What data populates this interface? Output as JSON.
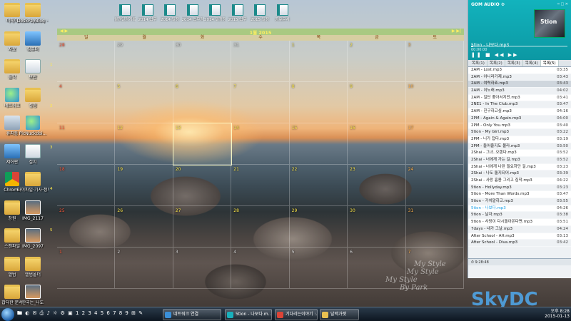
{
  "desktop": {
    "left_icons": [
      {
        "label": "더메이",
        "type": "folder"
      },
      {
        "label": "DeskPayBlog - 바로 가기",
        "type": "folder"
      },
      {
        "label": "자료",
        "type": "folder"
      },
      {
        "label": "컴퓨터",
        "type": "pc"
      },
      {
        "label": "음악",
        "type": "folder"
      },
      {
        "label": "보관",
        "type": "doc"
      },
      {
        "label": "네트워크",
        "type": "globe"
      },
      {
        "label": "설정",
        "type": "folder"
      },
      {
        "label": "휴지통",
        "type": "trash"
      },
      {
        "label": "PicNuckdoi...",
        "type": "globe"
      },
      {
        "label": "제어판",
        "type": "pc"
      },
      {
        "label": "설치",
        "type": "doc"
      },
      {
        "label": "Chrome",
        "type": "chrome"
      },
      {
        "label": "마이파일·기사·정보",
        "type": "folder"
      },
      {
        "label": "창원",
        "type": "folder"
      },
      {
        "label": "IMG_2117",
        "type": "photo"
      },
      {
        "label": "스캔파일",
        "type": "folder"
      },
      {
        "label": "IMG_2097",
        "type": "photo"
      },
      {
        "label": "앨범",
        "type": "folder"
      },
      {
        "label": "앨범폴더",
        "type": "folder"
      },
      {
        "label": "잡다한 문서",
        "type": "folder"
      },
      {
        "label": "한국는_나도",
        "type": "photo"
      }
    ],
    "top_icons": [
      {
        "label": "월간일정기록"
      },
      {
        "label": "2014 업무"
      },
      {
        "label": "2014 일정"
      },
      {
        "label": "2014 업무정리"
      },
      {
        "label": "2014 일정정리"
      },
      {
        "label": "2015 업무"
      },
      {
        "label": "2015 일정"
      },
      {
        "label": "공유문서"
      }
    ],
    "watermark": [
      "My Style",
      "My Style",
      "My Style",
      "By Park"
    ],
    "brand": "SkyDC"
  },
  "calendar": {
    "title": "1월 2015",
    "prev": "◀ ▶",
    "next": "▶ ▶|",
    "weekdays": [
      "일",
      "월",
      "화",
      "수",
      "목",
      "금",
      "토"
    ],
    "weeks": [
      [
        {
          "d": "28",
          "o": true
        },
        {
          "d": "29",
          "o": true
        },
        {
          "d": "30",
          "o": true
        },
        {
          "d": "31",
          "o": true
        },
        {
          "d": "1"
        },
        {
          "d": "2"
        },
        {
          "d": "3"
        }
      ],
      [
        {
          "d": "4"
        },
        {
          "d": "5"
        },
        {
          "d": "6"
        },
        {
          "d": "7"
        },
        {
          "d": "8"
        },
        {
          "d": "9"
        },
        {
          "d": "10"
        }
      ],
      [
        {
          "d": "11"
        },
        {
          "d": "12"
        },
        {
          "d": "13",
          "today": true
        },
        {
          "d": "14"
        },
        {
          "d": "15"
        },
        {
          "d": "16"
        },
        {
          "d": "17"
        }
      ],
      [
        {
          "d": "18"
        },
        {
          "d": "19"
        },
        {
          "d": "20"
        },
        {
          "d": "21"
        },
        {
          "d": "22"
        },
        {
          "d": "23"
        },
        {
          "d": "24"
        }
      ],
      [
        {
          "d": "25"
        },
        {
          "d": "26"
        },
        {
          "d": "27"
        },
        {
          "d": "28"
        },
        {
          "d": "29"
        },
        {
          "d": "30"
        },
        {
          "d": "31"
        }
      ],
      [
        {
          "d": "1",
          "o": true
        },
        {
          "d": "2",
          "o": true
        },
        {
          "d": "3",
          "o": true
        },
        {
          "d": "4",
          "o": true
        },
        {
          "d": "5",
          "o": true
        },
        {
          "d": "6",
          "o": true
        },
        {
          "d": "7",
          "o": true
        }
      ]
    ],
    "week_numbers": [
      "1",
      "2",
      "3",
      "4",
      "5"
    ]
  },
  "gom": {
    "title": "GOM AUDIO ⚙",
    "window_controls": "━ □ ✕",
    "album_art_text": "5tion",
    "now_playing": "5tion - 나보다.mp3",
    "elapsed": "00:00:00",
    "progress": 0.02,
    "controls": "❚❚ ■ ◀◀ ▶▶",
    "tabs": [
      "목록(1)",
      "목록(2)",
      "목록(3)",
      "목록(4)",
      "목록(5)"
    ],
    "active_tab": 4,
    "playlist": [
      {
        "t": "2AM - Lost.mp3",
        "tm": "03:35"
      },
      {
        "t": "2AM - 아니라가제.mp3",
        "tm": "03:43"
      },
      {
        "t": "2AM - 여력하죠.mp3",
        "tm": "03:43",
        "sel": true
      },
      {
        "t": "2AM - 이노래.mp3",
        "tm": "04:02"
      },
      {
        "t": "2AM - 일단 좋아서지만.mp3",
        "tm": "03:41"
      },
      {
        "t": "2NE1 - In The Club.mp3",
        "tm": "03:47"
      },
      {
        "t": "2AM - 친구하고싶.mp3",
        "tm": "04:16"
      },
      {
        "t": "2PM - Again & Again.mp3",
        "tm": "04:00"
      },
      {
        "t": "2PM - Only You.mp3",
        "tm": "03:40"
      },
      {
        "t": "5tion - My Girl.mp3",
        "tm": "03:22"
      },
      {
        "t": "2PM - 니가 접다.mp3",
        "tm": "03:19"
      },
      {
        "t": "2PM - 들어줄지도 몰라.mp3",
        "tm": "03:50"
      },
      {
        "t": "2Shai - 그녀..오렌다.mp3",
        "tm": "03:52"
      },
      {
        "t": "2Shai - 너에게 가는 길.mp3",
        "tm": "03:52"
      },
      {
        "t": "2Shai - 너에게 나란 필요하단 걸.mp3",
        "tm": "03:23"
      },
      {
        "t": "2Shai - 나도 돌지되어.mp3",
        "tm": "03:39"
      },
      {
        "t": "2Shai - 사랑 흉용 그리고 집착.mp3",
        "tm": "04:22"
      },
      {
        "t": "5tion - Hollyday.mp3",
        "tm": "03:23"
      },
      {
        "t": "5tion - More Than Words.mp3",
        "tm": "03:47"
      },
      {
        "t": "5tion - 가치말하고.mp3",
        "tm": "03:55"
      },
      {
        "t": "5tion - 나보다.mp3",
        "tm": "04:26",
        "cur": true
      },
      {
        "t": "5tion - 날자.mp3",
        "tm": "03:38"
      },
      {
        "t": "5tion - 사랑이 다시돌아온다면.mp3",
        "tm": "03:51"
      },
      {
        "t": "7days - 내가 그날.mp3",
        "tm": "04:24"
      },
      {
        "t": "After School - AH.mp3",
        "tm": "03:13"
      },
      {
        "t": "After School - Diva.mp3",
        "tm": "03:42"
      }
    ],
    "footer": "⏱ 9:28:48"
  },
  "taskbar": {
    "quick_launch": "🖿 ◐ ✉ ⎙ ♪ ☼ ⚙ ▣ 1 2 3 4 5 6 7 8 9 ⊞ ✎",
    "buttons": [
      {
        "label": "네트워크 연결",
        "color": "#3a8fd8"
      },
      {
        "label": "5tion - 나보다.m...",
        "color": "#18b0bc"
      },
      {
        "label": "기다리는이야기 :...",
        "color": "#db4437"
      },
      {
        "label": "달력가젯",
        "color": "#e8c050"
      }
    ],
    "clock_time": "오후 8:28",
    "clock_date": "2015-01-13"
  }
}
